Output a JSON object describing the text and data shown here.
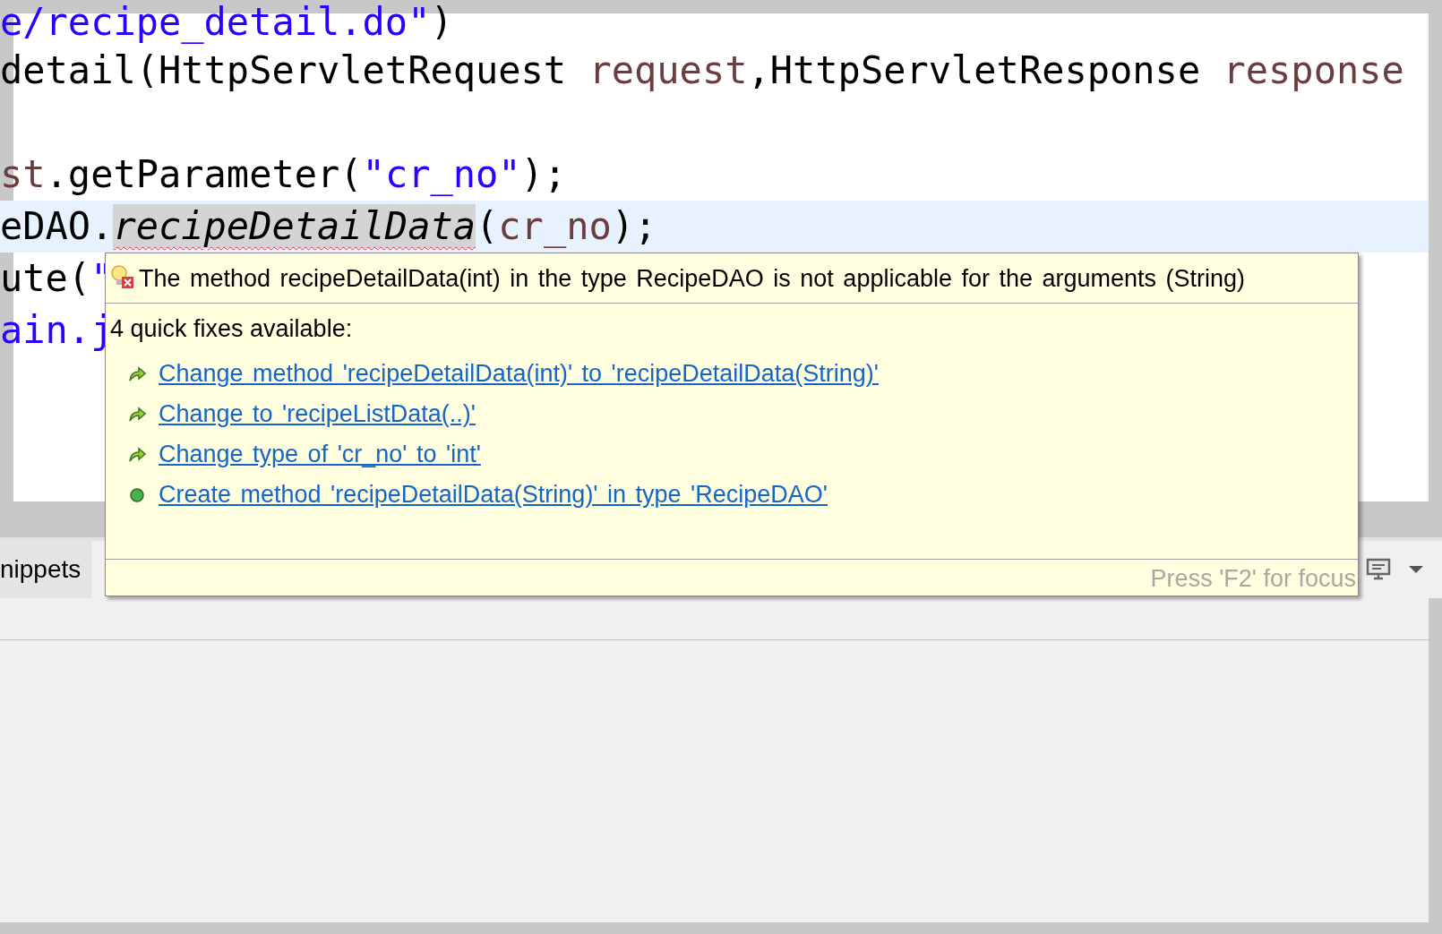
{
  "editor": {
    "lines": [
      {
        "current": false,
        "tokens": [
          {
            "kind": "string",
            "text": "e/recipe_detail.do\""
          },
          {
            "kind": "plain",
            "text": ")"
          }
        ]
      },
      {
        "current": false,
        "tokens": [
          {
            "kind": "plain",
            "text": "detail(HttpServletRequest "
          },
          {
            "kind": "variable",
            "text": "request"
          },
          {
            "kind": "plain",
            "text": ",HttpServletResponse "
          },
          {
            "kind": "variable",
            "text": "response"
          }
        ]
      },
      {
        "current": false
      },
      {
        "current": false,
        "tokens": [
          {
            "kind": "variable",
            "text": "st"
          },
          {
            "kind": "plain",
            "text": ".getParameter("
          },
          {
            "kind": "string",
            "text": "\"cr_no\""
          },
          {
            "kind": "plain",
            "text": ");"
          }
        ]
      },
      {
        "current": true,
        "tokens": [
          {
            "kind": "plain",
            "text": "eDAO."
          },
          {
            "kind": "error-method",
            "text": "recipeDetailData"
          },
          {
            "kind": "plain",
            "text": "("
          },
          {
            "kind": "variable",
            "text": "cr_no"
          },
          {
            "kind": "plain",
            "text": ");"
          }
        ]
      },
      {
        "current": false,
        "tokens": [
          {
            "kind": "plain",
            "text": "ute("
          },
          {
            "kind": "string",
            "text": "\""
          }
        ]
      },
      {
        "current": false,
        "tokens": [
          {
            "kind": "string",
            "text": "ain.j"
          }
        ]
      }
    ]
  },
  "popup": {
    "message": "The method recipeDetailData(int) in the type RecipeDAO is not applicable for the arguments (String)",
    "fixes_heading": "4 quick fixes available:",
    "fixes": [
      {
        "kind": "change",
        "label": "Change method 'recipeDetailData(int)' to 'recipeDetailData(String)'"
      },
      {
        "kind": "change",
        "label": "Change to 'recipeListData(..)'"
      },
      {
        "kind": "change",
        "label": "Change type of 'cr_no' to 'int'"
      },
      {
        "kind": "create",
        "label": "Create method 'recipeDetailData(String)' in type 'RecipeDAO'"
      }
    ],
    "footer": "Press 'F2' for focus"
  },
  "bottom_panel": {
    "tabs": [
      {
        "label": "nippets"
      }
    ]
  }
}
